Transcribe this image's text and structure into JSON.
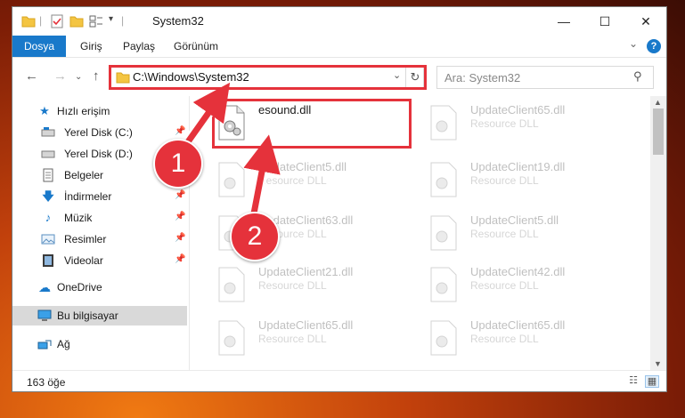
{
  "window": {
    "title": "System32"
  },
  "ribbon": {
    "tabs": [
      "Dosya",
      "Giriş",
      "Paylaş",
      "Görünüm"
    ]
  },
  "address": {
    "path": "C:\\Windows\\System32"
  },
  "search": {
    "placeholder": "Ara: System32"
  },
  "sidebar": {
    "items": [
      {
        "label": "Hızlı erişim",
        "icon": "star-icon"
      },
      {
        "label": "Yerel Disk (C:)",
        "icon": "drive-icon",
        "pinned": true
      },
      {
        "label": "Yerel Disk (D:)",
        "icon": "drive-icon",
        "pinned": true
      },
      {
        "label": "Belgeler",
        "icon": "documents-icon",
        "pinned": true
      },
      {
        "label": "İndirmeler",
        "icon": "download-icon",
        "pinned": true
      },
      {
        "label": "Müzik",
        "icon": "music-icon",
        "pinned": true
      },
      {
        "label": "Resimler",
        "icon": "pictures-icon",
        "pinned": true
      },
      {
        "label": "Videolar",
        "icon": "video-icon",
        "pinned": true
      },
      {
        "label": "OneDrive",
        "icon": "cloud-icon"
      },
      {
        "label": "Bu bilgisayar",
        "icon": "computer-icon",
        "selected": true
      },
      {
        "label": "Ağ",
        "icon": "network-icon"
      }
    ]
  },
  "files": [
    {
      "name": "esound.dll",
      "type": ""
    },
    {
      "name": "UpdateClient65.dll",
      "type": "Resource DLL"
    },
    {
      "name": "UpdateClient5.dll",
      "type": "Resource DLL"
    },
    {
      "name": "UpdateClient19.dll",
      "type": "Resource DLL"
    },
    {
      "name": "UpdateClient63.dll",
      "type": "Resource DLL"
    },
    {
      "name": "UpdateClient5.dll",
      "type": "Resource DLL"
    },
    {
      "name": "UpdateClient21.dll",
      "type": "Resource DLL"
    },
    {
      "name": "UpdateClient42.dll",
      "type": "Resource DLL"
    },
    {
      "name": "UpdateClient65.dll",
      "type": "Resource DLL"
    },
    {
      "name": "UpdateClient65.dll",
      "type": "Resource DLL"
    }
  ],
  "status": {
    "count": "163 öğe"
  },
  "annotations": {
    "step1": "1",
    "step2": "2"
  },
  "colors": {
    "accent": "#1979ca",
    "highlight": "#e5323b"
  }
}
